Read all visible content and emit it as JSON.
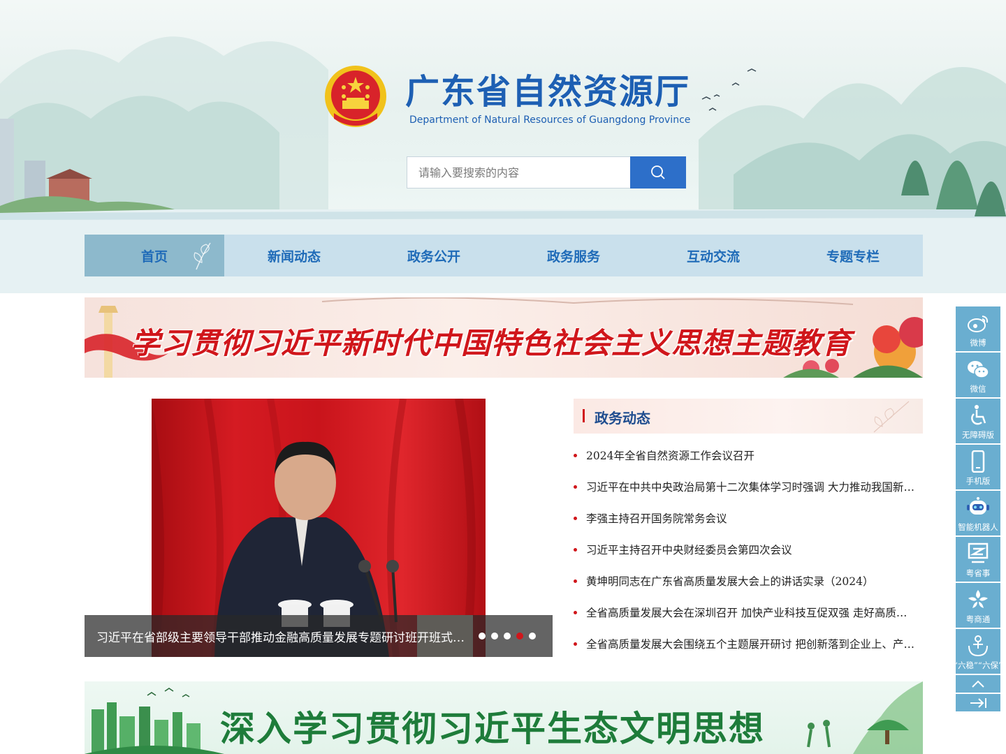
{
  "header": {
    "title": "广东省自然资源厅",
    "subtitle": "Department of Natural Resources of Guangdong Province"
  },
  "search": {
    "placeholder": "请输入要搜索的内容",
    "button_icon": "search-icon"
  },
  "nav": {
    "items": [
      {
        "label": "首页",
        "active": true
      },
      {
        "label": "新闻动态",
        "active": false
      },
      {
        "label": "政务公开",
        "active": false
      },
      {
        "label": "政务服务",
        "active": false
      },
      {
        "label": "互动交流",
        "active": false
      },
      {
        "label": "专题专栏",
        "active": false
      }
    ]
  },
  "banner_top": {
    "text": "学习贯彻习近平新时代中国特色社会主义思想主题教育"
  },
  "carousel": {
    "caption": "习近平在省部级主要领导干部推动金融高质量发展专题研讨班开班式上发表重要讲话",
    "slide_count": 5,
    "active_slide": 4
  },
  "news": {
    "title": "政务动态",
    "items": [
      "2024年全省自然资源工作会议召开",
      "习近平在中共中央政治局第十二次集体学习时强调 大力推动我国新能源高质量发展",
      "李强主持召开国务院常务会议",
      "习近平主持召开中央财经委员会第四次会议",
      "黄坤明同志在广东省高质量发展大会上的讲话实录（2024）",
      "全省高质量发展大会在深圳召开 加快产业科技互促双强 走好高质量发展之路",
      "全省高质量发展大会围绕五个主题展开研讨 把创新落到企业上、产业上"
    ]
  },
  "banner_bottom": {
    "text": "深入学习贯彻习近平生态文明思想"
  },
  "sidebar": {
    "items": [
      {
        "label": "微博",
        "icon": "weibo-icon"
      },
      {
        "label": "微信",
        "icon": "wechat-icon"
      },
      {
        "label": "无障碍版",
        "icon": "accessibility-icon"
      },
      {
        "label": "手机版",
        "icon": "mobile-icon"
      },
      {
        "label": "智能机器人",
        "icon": "robot-icon"
      },
      {
        "label": "粤省事",
        "icon": "yueshengshi-icon"
      },
      {
        "label": "粤商通",
        "icon": "yueshangtong-icon"
      },
      {
        "label": "“六稳”“六保”",
        "icon": "liuwen-liubao-icon"
      }
    ],
    "up_icon": "chevron-up-icon",
    "collapse_icon": "collapse-right-icon"
  },
  "colors": {
    "brand_blue": "#1d5fb3",
    "accent_red": "#d0161b",
    "nav_bg": "#c9e0ec",
    "nav_active": "#8db9cc",
    "sidebar_bg": "#6aaed0"
  }
}
